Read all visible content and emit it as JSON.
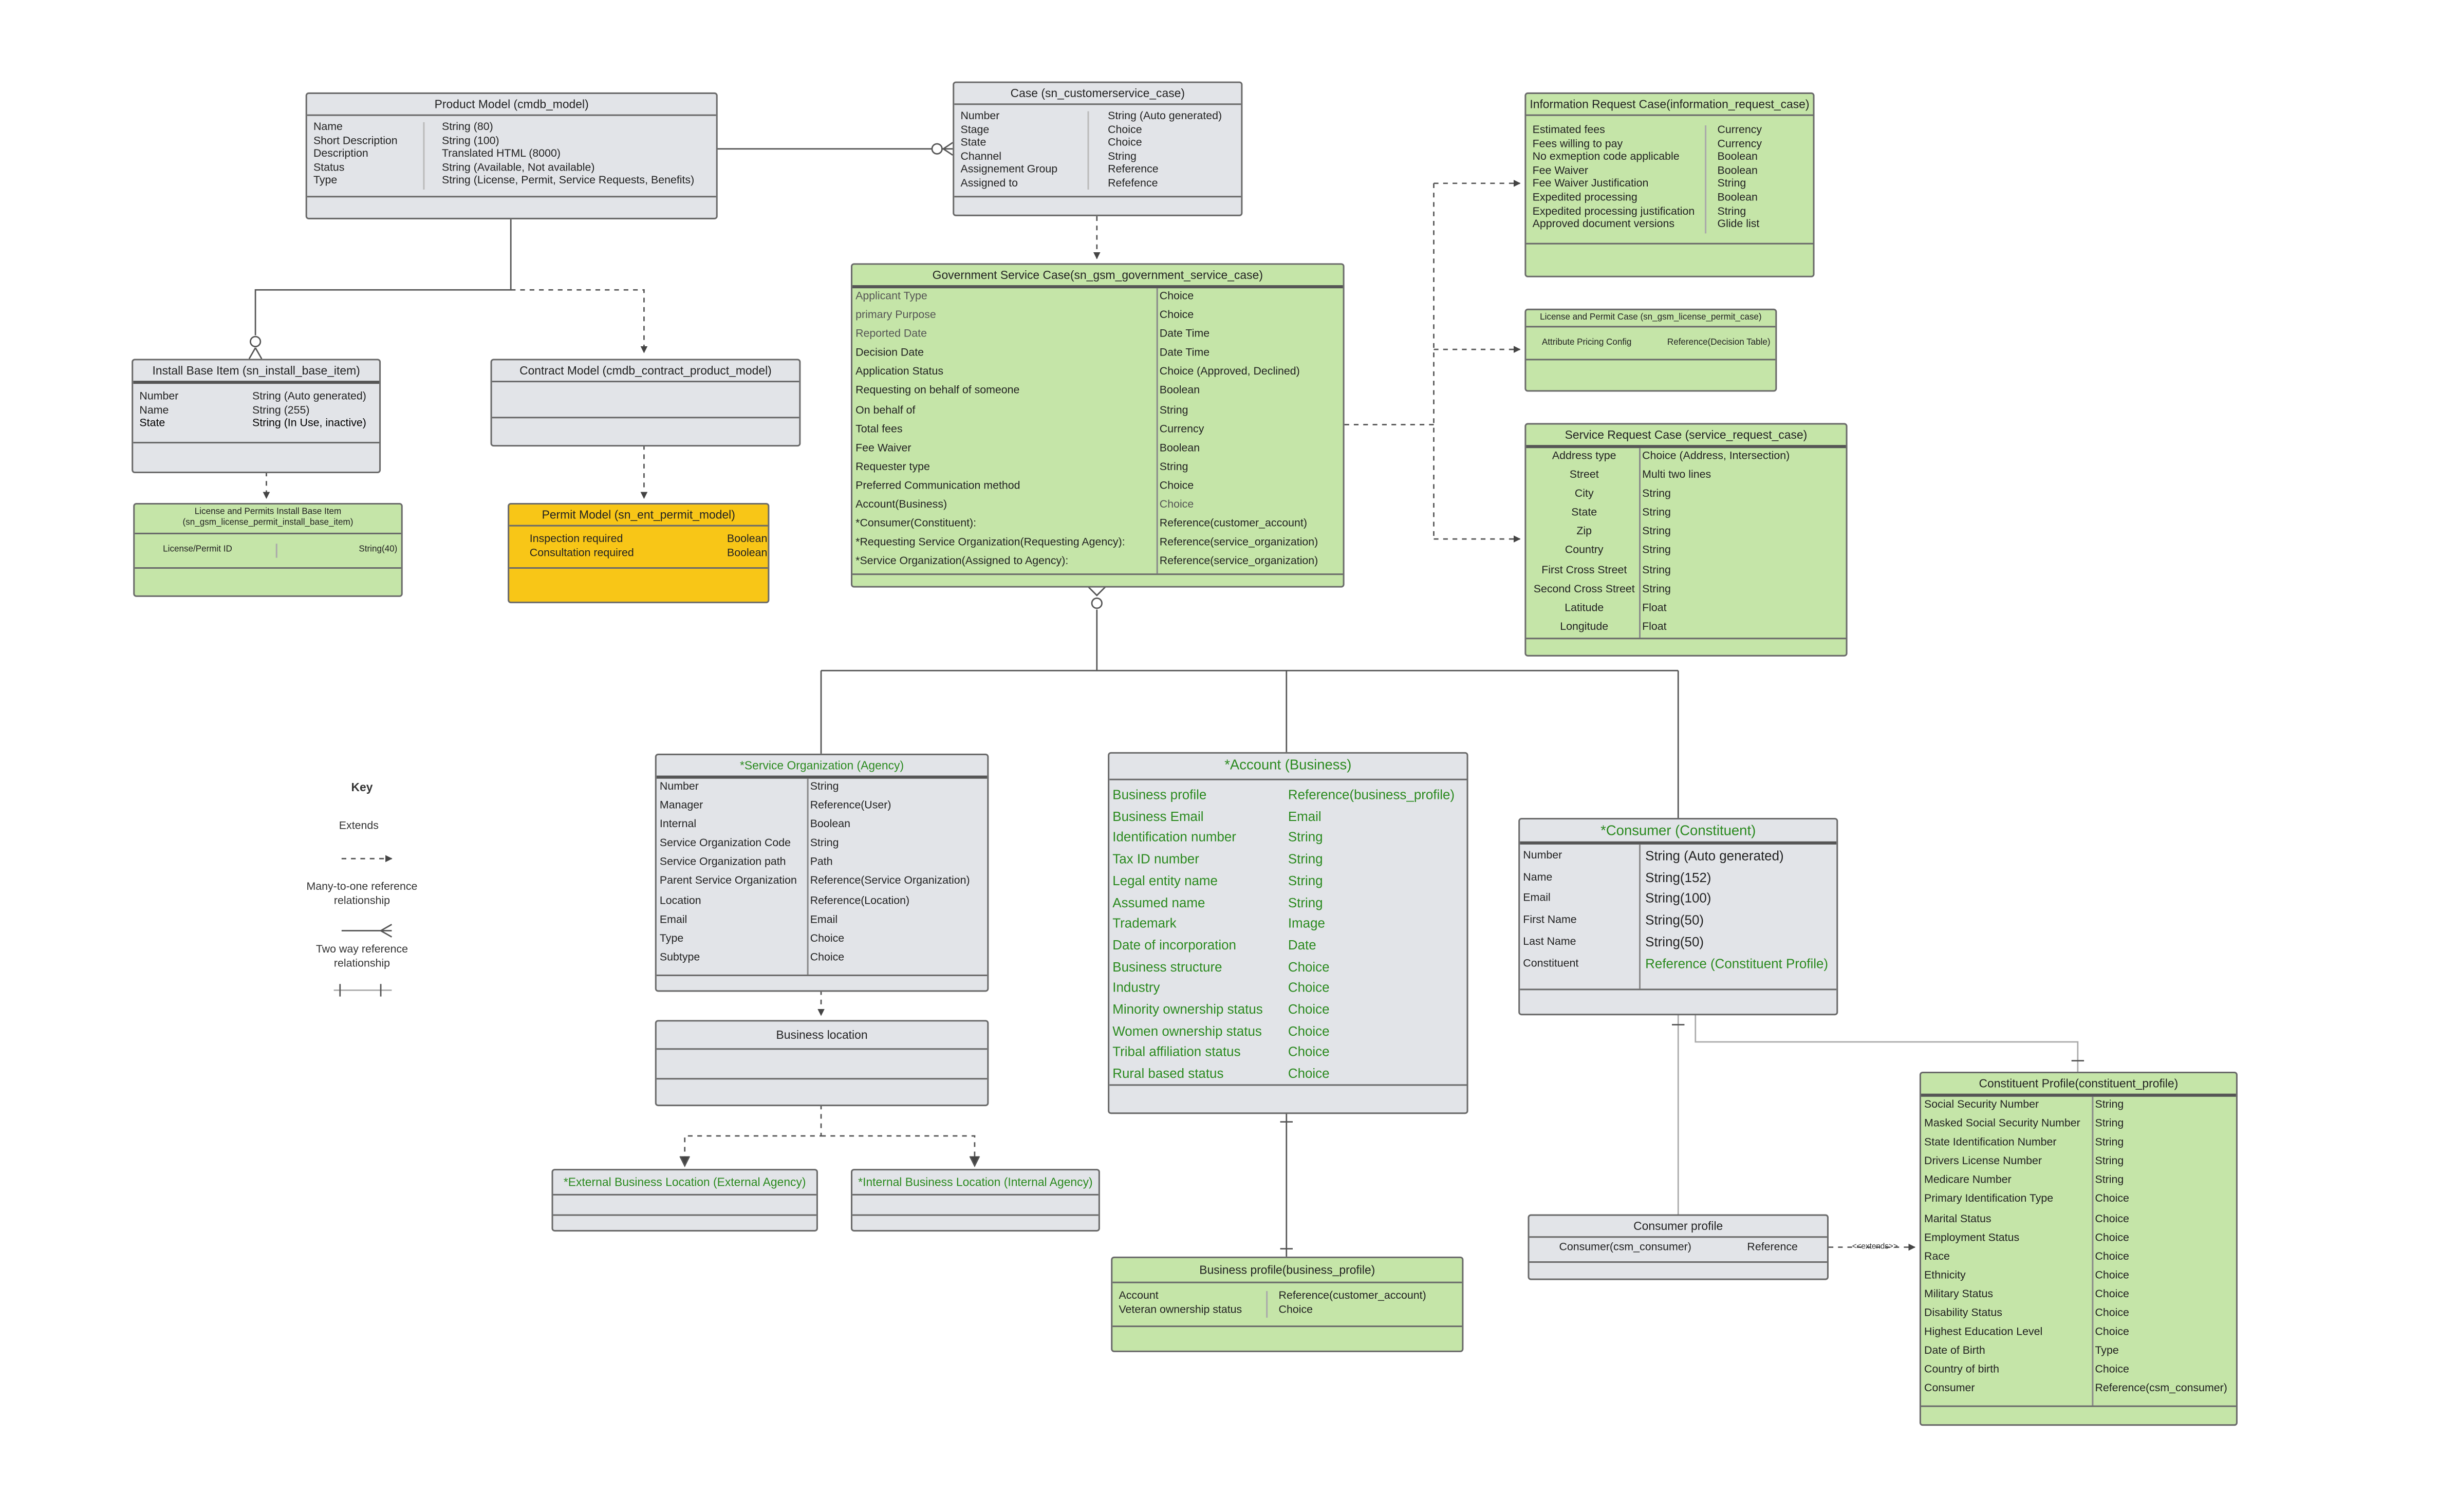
{
  "entities": {
    "product_model": {
      "title": "Product Model (cmdb_model)",
      "rows": [
        {
          "field": "Name",
          "type": "String (80)"
        },
        {
          "field": "Short Description",
          "type": "String (100)"
        },
        {
          "field": "Description",
          "type": "Translated HTML (8000)"
        },
        {
          "field": "Status",
          "type": "String  (Available, Not available)"
        },
        {
          "field": "Type",
          "type": "String (License, Permit, Service Requests, Benefits)"
        }
      ]
    },
    "case": {
      "title": "Case (sn_customerservice_case)",
      "rows": [
        {
          "field": "Number",
          "type": "String (Auto generated)"
        },
        {
          "field": "Stage",
          "type": "Choice"
        },
        {
          "field": "State",
          "type": "Choice"
        },
        {
          "field": "Channel",
          "type": "String"
        },
        {
          "field": "Assignement Group",
          "type": "Reference"
        },
        {
          "field": "Assigned to",
          "type": "Refefence"
        }
      ]
    },
    "info_request": {
      "title": "Information Request Case(information_request_case)",
      "rows": [
        {
          "field": "Estimated fees",
          "type": "Currency"
        },
        {
          "field": "Fees willing to pay",
          "type": "Currency"
        },
        {
          "field": "No exmeption code applicable",
          "type": "Boolean"
        },
        {
          "field": "Fee Waiver",
          "type": "Boolean"
        },
        {
          "field": "Fee Waiver Justification",
          "type": "String"
        },
        {
          "field": "Expedited processing",
          "type": "Boolean"
        },
        {
          "field": "Expedited processing justification",
          "type": "String"
        },
        {
          "field": "Approved document versions",
          "type": "Glide list"
        }
      ]
    },
    "license_permit_case": {
      "title": "License and Permit Case (sn_gsm_license_permit_case)",
      "rows": [
        {
          "field": "Attribute Pricing Config",
          "type": "Reference(Decision Table)"
        }
      ]
    },
    "service_request_case": {
      "title": "Service Request Case (service_request_case)",
      "rows": [
        {
          "field": "Address type",
          "type": "Choice (Address, Intersection)"
        },
        {
          "field": "Street",
          "type": "Multi two lines"
        },
        {
          "field": "City",
          "type": "String"
        },
        {
          "field": "State",
          "type": "String"
        },
        {
          "field": "Zip",
          "type": "String"
        },
        {
          "field": "Country",
          "type": "String"
        },
        {
          "field": "First Cross Street",
          "type": "String"
        },
        {
          "field": "Second Cross Street",
          "type": "String"
        },
        {
          "field": "Latitude",
          "type": "Float"
        },
        {
          "field": "Longitude",
          "type": "Float"
        }
      ]
    },
    "gov_service_case": {
      "title": "Government Service Case(sn_gsm_government_service_case)",
      "rows": [
        {
          "field": "Applicant Type",
          "type": "Choice",
          "muted": true
        },
        {
          "field": "primary Purpose",
          "type": "Choice",
          "muted": true
        },
        {
          "field": "Reported Date",
          "type": "Date Time",
          "muted": true
        },
        {
          "field": "Decision Date",
          "type": "Date Time"
        },
        {
          "field": "Application Status",
          "type": "Choice (Approved, Declined)"
        },
        {
          "field": "Requesting on behalf of someone",
          "type": "Boolean"
        },
        {
          "field": "On behalf of",
          "type": "String"
        },
        {
          "field": "Total fees",
          "type": "Currency"
        },
        {
          "field": "Fee Waiver",
          "type": "Boolean"
        },
        {
          "field": "Requester type",
          "type": "String"
        },
        {
          "field": "Preferred Communication method",
          "type": "Choice"
        },
        {
          "field": "Account(Business)",
          "type": "Choice",
          "typeMuted": true
        },
        {
          "field": "*Consumer(Constituent):",
          "type": "Reference(customer_account)"
        },
        {
          "field": "*Requesting Service Organization(Requesting Agency):",
          "type": "Reference(service_organization)"
        },
        {
          "field": "*Service Organization(Assigned to Agency):",
          "type": "Reference(service_organization)"
        }
      ]
    },
    "install_base": {
      "title": "Install Base Item (sn_install_base_item)",
      "rows": [
        {
          "field": "Number",
          "type": "String (Auto generated)"
        },
        {
          "field": "Name",
          "type": "String (255)"
        },
        {
          "field": "State",
          "type": "String (In Use, inactive)"
        }
      ]
    },
    "contract_model": {
      "title": "Contract Model (cmdb_contract_product_model)",
      "rows": []
    },
    "license_permit_install": {
      "title_line1": "License and Permits Install Base Item",
      "title_line2": "(sn_gsm_license_permit_install_base_item)",
      "rows": [
        {
          "field": "License/Permit ID",
          "type": "String(40)"
        }
      ]
    },
    "permit_model": {
      "title": "Permit Model (sn_ent_permit_model)",
      "rows": [
        {
          "field": "Inspection required",
          "type": "Boolean"
        },
        {
          "field": "Consultation required",
          "type": "Boolean"
        }
      ]
    },
    "service_org": {
      "title": "*Service Organization (Agency)",
      "rows": [
        {
          "field": "Number",
          "type": "String"
        },
        {
          "field": "Manager",
          "type": "Reference(User)"
        },
        {
          "field": "Internal",
          "type": "Boolean"
        },
        {
          "field": "Service Organization Code",
          "type": "String"
        },
        {
          "field": "Service Organization path",
          "type": "Path"
        },
        {
          "field": "Parent Service Organization",
          "type": "Reference(Service Organization)"
        },
        {
          "field": "Location",
          "type": "Reference(Location)"
        },
        {
          "field": "Email",
          "type": "Email"
        },
        {
          "field": "Type",
          "type": "Choice"
        },
        {
          "field": "Subtype",
          "type": "Choice"
        }
      ]
    },
    "business_location": {
      "title": "Business location",
      "rows": []
    },
    "external_location": {
      "title": "*External Business Location (External Agency)",
      "rows": []
    },
    "internal_location": {
      "title": "*Internal Business Location (Internal Agency)",
      "rows": []
    },
    "account": {
      "title": "*Account (Business)",
      "rows": [
        {
          "field": "Business profile",
          "type": "Reference(business_profile)"
        },
        {
          "field": "Business Email",
          "type": "Email"
        },
        {
          "field": "Identification number",
          "type": "String"
        },
        {
          "field": "Tax ID number",
          "type": "String"
        },
        {
          "field": "Legal entity name",
          "type": "String"
        },
        {
          "field": "Assumed name",
          "type": "String"
        },
        {
          "field": "Trademark",
          "type": "Image"
        },
        {
          "field": "Date of incorporation",
          "type": "Date"
        },
        {
          "field": "Business structure",
          "type": "Choice"
        },
        {
          "field": "Industry",
          "type": "Choice"
        },
        {
          "field": "Minority ownership status",
          "type": "Choice"
        },
        {
          "field": "Women ownership status",
          "type": "Choice"
        },
        {
          "field": "Tribal affiliation status",
          "type": "Choice"
        },
        {
          "field": "Rural based status",
          "type": "Choice"
        }
      ]
    },
    "business_profile": {
      "title": "Business profile(business_profile)",
      "rows": [
        {
          "field": "Account",
          "type": "Reference(customer_account)"
        },
        {
          "field": "Veteran ownership status",
          "type": "Choice"
        }
      ]
    },
    "consumer": {
      "title": "*Consumer (Constituent)",
      "rows": [
        {
          "field": "Number",
          "type": "String (Auto generated)"
        },
        {
          "field": "Name",
          "type": "String(152)"
        },
        {
          "field": "Email",
          "type": "String(100)"
        },
        {
          "field": "First Name",
          "type": "String(50)"
        },
        {
          "field": "Last Name",
          "type": "String(50)"
        },
        {
          "field": "Constituent",
          "type": "Reference (Constituent Profile)",
          "typeGreen": true
        }
      ]
    },
    "consumer_profile": {
      "title": "Consumer profile",
      "rows": [
        {
          "field": "Consumer(csm_consumer)",
          "type": "Reference"
        }
      ]
    },
    "constituent_profile": {
      "title": "Constituent Profile(constituent_profile)",
      "rows": [
        {
          "field": "Social Security Number",
          "type": "String"
        },
        {
          "field": "Masked Social Security Number",
          "type": "String"
        },
        {
          "field": "State Identification Number",
          "type": "String"
        },
        {
          "field": "Drivers License Number",
          "type": "String"
        },
        {
          "field": "Medicare Number",
          "type": "String"
        },
        {
          "field": "Primary Identification Type",
          "type": "Choice"
        },
        {
          "field": "Marital Status",
          "type": "Choice"
        },
        {
          "field": "Employment Status",
          "type": "Choice"
        },
        {
          "field": "Race",
          "type": "Choice"
        },
        {
          "field": "Ethnicity",
          "type": "Choice"
        },
        {
          "field": "Military Status",
          "type": "Choice"
        },
        {
          "field": "Disability Status",
          "type": "Choice"
        },
        {
          "field": "Highest Education Level",
          "type": "Choice"
        },
        {
          "field": "Date of Birth",
          "type": "Type"
        },
        {
          "field": "Country of birth",
          "type": "Choice"
        },
        {
          "field": "Consumer",
          "type": "Reference(csm_consumer)"
        }
      ]
    }
  },
  "key": {
    "title": "Key",
    "extends": "Extends",
    "many_to_one_line1": "Many-to-one reference",
    "many_to_one_line2": "relationship",
    "two_way_line1": "Two way reference",
    "two_way_line2": "relationship"
  },
  "edge_labels": {
    "extends_stereotype": "<<extends>>"
  },
  "colors": {
    "gray_fill": "#e2e4e8",
    "green_fill": "#c5e5a8",
    "yellow_fill": "#f8c617",
    "green_text": "#2b8a1f",
    "line": "#555555"
  }
}
